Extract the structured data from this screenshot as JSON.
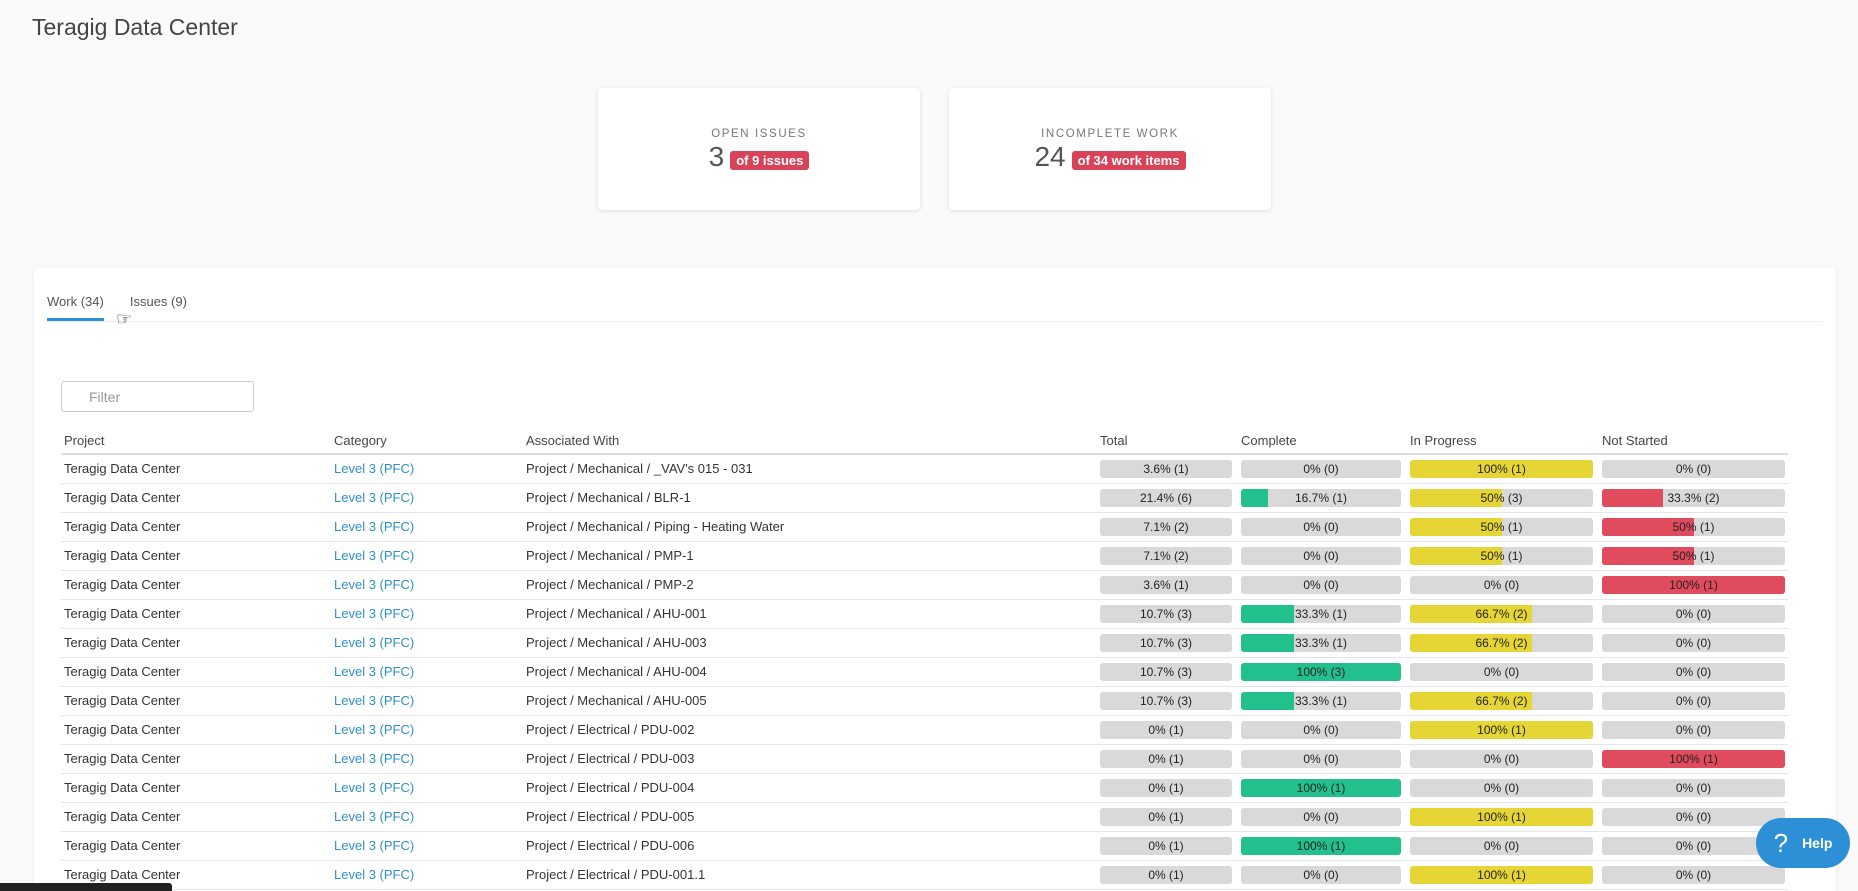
{
  "page": {
    "title": "Teragig Data Center"
  },
  "kpis": [
    {
      "label": "OPEN ISSUES",
      "value": "3",
      "badge": "of 9 issues"
    },
    {
      "label": "INCOMPLETE WORK",
      "value": "24",
      "badge": "of 34 work items"
    }
  ],
  "tabs": [
    {
      "label": "Work (34)",
      "active": true
    },
    {
      "label": "Issues (9)",
      "active": false
    }
  ],
  "filter": {
    "placeholder": "Filter",
    "value": ""
  },
  "columns": [
    "Project",
    "Category",
    "Associated With",
    "Total",
    "Complete",
    "In Progress",
    "Not Started"
  ],
  "colors": {
    "total": "#d9d9d9",
    "complete": "#22c08d",
    "in_progress": "#e5d635",
    "not_started": "#e04b5e",
    "link": "#2f8fc9",
    "accent": "#2d8fd5"
  },
  "rows": [
    {
      "project": "Teragig Data Center",
      "category": "Level 3 (PFC)",
      "associated": "Project / Mechanical / _VAV's 015 - 031",
      "total": {
        "label": "3.6% (1)",
        "pct": 0
      },
      "complete": {
        "label": "0% (0)",
        "pct": 0
      },
      "in_progress": {
        "label": "100% (1)",
        "pct": 100
      },
      "not_started": {
        "label": "0% (0)",
        "pct": 0
      }
    },
    {
      "project": "Teragig Data Center",
      "category": "Level 3 (PFC)",
      "associated": "Project / Mechanical / BLR-1",
      "total": {
        "label": "21.4% (6)",
        "pct": 0
      },
      "complete": {
        "label": "16.7% (1)",
        "pct": 16.7
      },
      "in_progress": {
        "label": "50% (3)",
        "pct": 50
      },
      "not_started": {
        "label": "33.3% (2)",
        "pct": 33.3
      }
    },
    {
      "project": "Teragig Data Center",
      "category": "Level 3 (PFC)",
      "associated": "Project / Mechanical / Piping - Heating Water",
      "total": {
        "label": "7.1% (2)",
        "pct": 0
      },
      "complete": {
        "label": "0% (0)",
        "pct": 0
      },
      "in_progress": {
        "label": "50% (1)",
        "pct": 50
      },
      "not_started": {
        "label": "50% (1)",
        "pct": 50
      }
    },
    {
      "project": "Teragig Data Center",
      "category": "Level 3 (PFC)",
      "associated": "Project / Mechanical / PMP-1",
      "total": {
        "label": "7.1% (2)",
        "pct": 0
      },
      "complete": {
        "label": "0% (0)",
        "pct": 0
      },
      "in_progress": {
        "label": "50% (1)",
        "pct": 50
      },
      "not_started": {
        "label": "50% (1)",
        "pct": 50
      }
    },
    {
      "project": "Teragig Data Center",
      "category": "Level 3 (PFC)",
      "associated": "Project / Mechanical / PMP-2",
      "total": {
        "label": "3.6% (1)",
        "pct": 0
      },
      "complete": {
        "label": "0% (0)",
        "pct": 0
      },
      "in_progress": {
        "label": "0% (0)",
        "pct": 0
      },
      "not_started": {
        "label": "100% (1)",
        "pct": 100
      }
    },
    {
      "project": "Teragig Data Center",
      "category": "Level 3 (PFC)",
      "associated": "Project / Mechanical / AHU-001",
      "total": {
        "label": "10.7% (3)",
        "pct": 0
      },
      "complete": {
        "label": "33.3% (1)",
        "pct": 33.3
      },
      "in_progress": {
        "label": "66.7% (2)",
        "pct": 66.7
      },
      "not_started": {
        "label": "0% (0)",
        "pct": 0
      }
    },
    {
      "project": "Teragig Data Center",
      "category": "Level 3 (PFC)",
      "associated": "Project / Mechanical / AHU-003",
      "total": {
        "label": "10.7% (3)",
        "pct": 0
      },
      "complete": {
        "label": "33.3% (1)",
        "pct": 33.3
      },
      "in_progress": {
        "label": "66.7% (2)",
        "pct": 66.7
      },
      "not_started": {
        "label": "0% (0)",
        "pct": 0
      }
    },
    {
      "project": "Teragig Data Center",
      "category": "Level 3 (PFC)",
      "associated": "Project / Mechanical / AHU-004",
      "total": {
        "label": "10.7% (3)",
        "pct": 0
      },
      "complete": {
        "label": "100% (3)",
        "pct": 100
      },
      "in_progress": {
        "label": "0% (0)",
        "pct": 0
      },
      "not_started": {
        "label": "0% (0)",
        "pct": 0
      }
    },
    {
      "project": "Teragig Data Center",
      "category": "Level 3 (PFC)",
      "associated": "Project / Mechanical / AHU-005",
      "total": {
        "label": "10.7% (3)",
        "pct": 0
      },
      "complete": {
        "label": "33.3% (1)",
        "pct": 33.3
      },
      "in_progress": {
        "label": "66.7% (2)",
        "pct": 66.7
      },
      "not_started": {
        "label": "0% (0)",
        "pct": 0
      }
    },
    {
      "project": "Teragig Data Center",
      "category": "Level 3 (PFC)",
      "associated": "Project / Electrical / PDU-002",
      "total": {
        "label": "0% (1)",
        "pct": 0
      },
      "complete": {
        "label": "0% (0)",
        "pct": 0
      },
      "in_progress": {
        "label": "100% (1)",
        "pct": 100
      },
      "not_started": {
        "label": "0% (0)",
        "pct": 0
      }
    },
    {
      "project": "Teragig Data Center",
      "category": "Level 3 (PFC)",
      "associated": "Project / Electrical / PDU-003",
      "total": {
        "label": "0% (1)",
        "pct": 0
      },
      "complete": {
        "label": "0% (0)",
        "pct": 0
      },
      "in_progress": {
        "label": "0% (0)",
        "pct": 0
      },
      "not_started": {
        "label": "100% (1)",
        "pct": 100
      }
    },
    {
      "project": "Teragig Data Center",
      "category": "Level 3 (PFC)",
      "associated": "Project / Electrical / PDU-004",
      "total": {
        "label": "0% (1)",
        "pct": 0
      },
      "complete": {
        "label": "100% (1)",
        "pct": 100
      },
      "in_progress": {
        "label": "0% (0)",
        "pct": 0
      },
      "not_started": {
        "label": "0% (0)",
        "pct": 0
      }
    },
    {
      "project": "Teragig Data Center",
      "category": "Level 3 (PFC)",
      "associated": "Project / Electrical / PDU-005",
      "total": {
        "label": "0% (1)",
        "pct": 0
      },
      "complete": {
        "label": "0% (0)",
        "pct": 0
      },
      "in_progress": {
        "label": "100% (1)",
        "pct": 100
      },
      "not_started": {
        "label": "0% (0)",
        "pct": 0
      }
    },
    {
      "project": "Teragig Data Center",
      "category": "Level 3 (PFC)",
      "associated": "Project / Electrical / PDU-006",
      "total": {
        "label": "0% (1)",
        "pct": 0
      },
      "complete": {
        "label": "100% (1)",
        "pct": 100
      },
      "in_progress": {
        "label": "0% (0)",
        "pct": 0
      },
      "not_started": {
        "label": "0% (0)",
        "pct": 0
      }
    },
    {
      "project": "Teragig Data Center",
      "category": "Level 3 (PFC)",
      "associated": "Project / Electrical / PDU-001.1",
      "total": {
        "label": "0% (1)",
        "pct": 0
      },
      "complete": {
        "label": "0% (0)",
        "pct": 0
      },
      "in_progress": {
        "label": "100% (1)",
        "pct": 100
      },
      "not_started": {
        "label": "0% (0)",
        "pct": 0
      }
    }
  ],
  "help": {
    "label": "Help",
    "icon": "question-icon"
  }
}
